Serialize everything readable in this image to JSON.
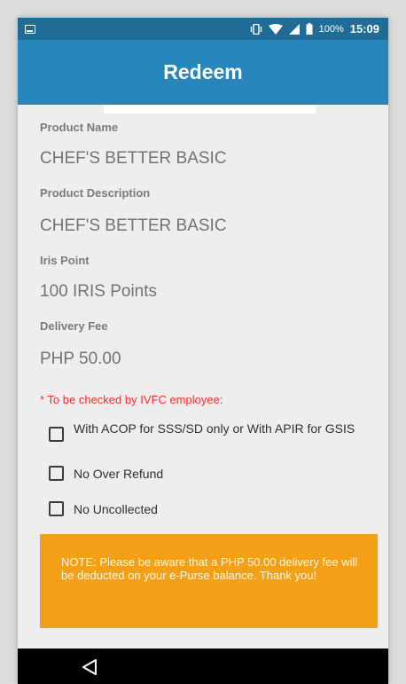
{
  "status_bar": {
    "battery_percent": "100%",
    "time": "15:09"
  },
  "app_bar": {
    "title": "Redeem"
  },
  "fields": [
    {
      "label": "Product Name",
      "value": "CHEF'S BETTER BASIC"
    },
    {
      "label": "Product Description",
      "value": "CHEF'S BETTER BASIC"
    },
    {
      "label": "Iris Point",
      "value": "100 IRIS Points"
    },
    {
      "label": "Delivery Fee",
      "value": "PHP 50.00"
    }
  ],
  "checklist": {
    "heading": "* To be checked by IVFC employee:",
    "items": [
      {
        "label": "With ACOP for SSS/SD only or With APIR for GSIS",
        "checked": false
      },
      {
        "label": "No Over Refund",
        "checked": false
      },
      {
        "label": "No Uncollected",
        "checked": false
      }
    ]
  },
  "note": {
    "text": "NOTE: Please be aware that a PHP 50.00 delivery fee will be deducted on your e-Purse balance. Thank you!"
  },
  "colors": {
    "status_bar": "#1f6d96",
    "app_bar": "#2787bd",
    "note_background": "#f4a017",
    "required_text": "#ff2a2a"
  },
  "icons": {
    "status_left": "screenshot-icon",
    "vibrate": "vibrate-icon",
    "wifi": "wifi-icon",
    "signal": "signal-icon",
    "battery": "battery-icon",
    "back": "back-triangle-icon"
  }
}
